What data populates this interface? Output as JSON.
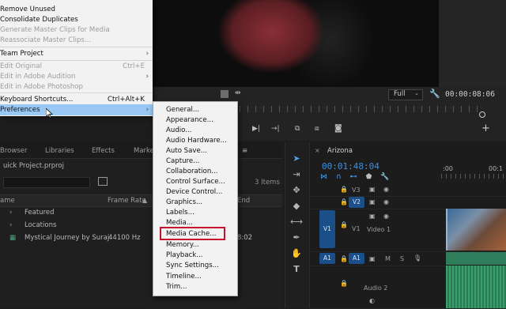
{
  "menu": {
    "items": [
      {
        "label": "Remove Unused",
        "disabled": false
      },
      {
        "label": "Consolidate Duplicates",
        "disabled": false
      },
      {
        "label": "Generate Master Clips for Media",
        "disabled": true
      },
      {
        "label": "Reassociate Master Clips...",
        "disabled": true
      },
      {
        "label": "Team Project",
        "disabled": false,
        "submenu": true
      },
      {
        "label": "Edit Original",
        "disabled": true,
        "shortcut": "Ctrl+E"
      },
      {
        "label": "Edit in Adobe Audition",
        "disabled": true,
        "submenu": true
      },
      {
        "label": "Edit in Adobe Photoshop",
        "disabled": true
      },
      {
        "label": "Keyboard Shortcuts...",
        "disabled": false,
        "shortcut": "Ctrl+Alt+K"
      },
      {
        "label": "Preferences",
        "disabled": false,
        "submenu": true,
        "highlighted": true
      }
    ]
  },
  "submenu": {
    "items": [
      "General...",
      "Appearance...",
      "Audio...",
      "Audio Hardware...",
      "Auto Save...",
      "Capture...",
      "Collaboration...",
      "Control Surface...",
      "Device Control...",
      "Graphics...",
      "Labels...",
      "Media...",
      "Media Cache...",
      "Memory...",
      "Playback...",
      "Sync Settings...",
      "Timeline...",
      "Trim..."
    ],
    "highlighted_item": "Media Cache..."
  },
  "monitor": {
    "fit": "Full",
    "timecode": "00:00:08:06"
  },
  "panel_tabs": [
    "Browser",
    "Libraries",
    "Effects",
    "Marke"
  ],
  "project": {
    "name": "uick Project.prproj",
    "item_count": "3 Items",
    "columns": {
      "name": "ame",
      "frame_rate": "Frame Rate",
      "end": "End"
    },
    "rows": [
      {
        "name": "Featured",
        "type": "folder",
        "frame_rate": "",
        "end": ""
      },
      {
        "name": "Locations",
        "type": "folder",
        "frame_rate": "",
        "end": ""
      },
      {
        "name": "Mystical Journey  by Suraj",
        "type": "sequence",
        "frame_rate": "44100 Hz",
        "end": "8:02"
      }
    ]
  },
  "timeline": {
    "sequence": "Arizona",
    "timecode": "00:01:48:04",
    "ruler": [
      ":00",
      "00:1"
    ],
    "tracks": [
      {
        "id": "V3",
        "kind": "video"
      },
      {
        "id": "V2",
        "kind": "video"
      },
      {
        "id": "V1",
        "kind": "video",
        "source": "V1",
        "name": "Video 1"
      },
      {
        "id": "A1",
        "kind": "audio",
        "source": "A1"
      },
      {
        "id": "A2",
        "kind": "audio",
        "name": "Audio 2"
      }
    ],
    "mute_label": "M",
    "solo_label": "S"
  },
  "colors": {
    "accent": "#3d8fe0",
    "menu_highlight": "#99c8f5",
    "track_selected": "#1b4f8a",
    "callout": "#c8102e"
  }
}
